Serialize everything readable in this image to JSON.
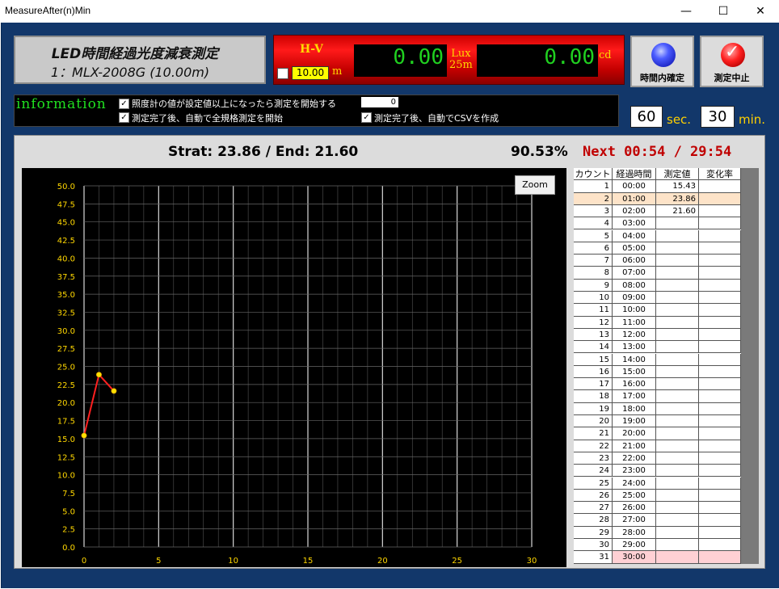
{
  "window": {
    "title": "MeasureAfter(n)Min",
    "minimize": "—",
    "maximize": "☐",
    "close": "✕"
  },
  "header": {
    "title_line1": "LED時間経過光度減衰測定",
    "title_line2": "1：MLX-2008G (10.00m)"
  },
  "meter": {
    "hv_label": "H-V",
    "hv_value": "10.00",
    "hv_unit": "m",
    "lux_value": "0.00",
    "lux_unit_line1": "Lux",
    "lux_unit_line2": "25m",
    "cd_value": "0.00",
    "cd_unit": "cd"
  },
  "buttons": {
    "confirm_label": "時間内確定",
    "stop_label": "測定中止"
  },
  "info": {
    "title": "information",
    "opt1_label": "照度計の値が設定値以上になったら測定を開始する",
    "opt1_value": "0",
    "opt2_label": "測定完了後、自動で全規格測定を開始",
    "opt3_label": "測定完了後、自動でCSVを作成"
  },
  "timing": {
    "sec_value": "60",
    "sec_unit": "sec.",
    "min_value": "30",
    "min_unit": "min."
  },
  "status": {
    "start_end": "Strat: 23.86  / End: 21.60",
    "percent": "90.53%",
    "next": "Next 00:54 / 29:54"
  },
  "zoom_label": "Zoom",
  "table": {
    "headers": [
      "カウント",
      "経過時間",
      "測定値",
      "変化率"
    ],
    "rows": [
      [
        "1",
        "00:00",
        "15.43",
        ""
      ],
      [
        "2",
        "01:00",
        "23.86",
        ""
      ],
      [
        "3",
        "02:00",
        "21.60",
        ""
      ],
      [
        "4",
        "03:00",
        "",
        ""
      ],
      [
        "5",
        "04:00",
        "",
        ""
      ],
      [
        "6",
        "05:00",
        "",
        ""
      ],
      [
        "7",
        "06:00",
        "",
        ""
      ],
      [
        "8",
        "07:00",
        "",
        ""
      ],
      [
        "9",
        "08:00",
        "",
        ""
      ],
      [
        "10",
        "09:00",
        "",
        ""
      ],
      [
        "11",
        "10:00",
        "",
        ""
      ],
      [
        "12",
        "11:00",
        "",
        ""
      ],
      [
        "13",
        "12:00",
        "",
        ""
      ],
      [
        "14",
        "13:00",
        "",
        ""
      ],
      [
        "15",
        "14:00",
        "",
        ""
      ],
      [
        "16",
        "15:00",
        "",
        ""
      ],
      [
        "17",
        "16:00",
        "",
        ""
      ],
      [
        "18",
        "17:00",
        "",
        ""
      ],
      [
        "19",
        "18:00",
        "",
        ""
      ],
      [
        "20",
        "19:00",
        "",
        ""
      ],
      [
        "21",
        "20:00",
        "",
        ""
      ],
      [
        "22",
        "21:00",
        "",
        ""
      ],
      [
        "23",
        "22:00",
        "",
        ""
      ],
      [
        "24",
        "23:00",
        "",
        ""
      ],
      [
        "25",
        "24:00",
        "",
        ""
      ],
      [
        "26",
        "25:00",
        "",
        ""
      ],
      [
        "27",
        "26:00",
        "",
        ""
      ],
      [
        "28",
        "27:00",
        "",
        ""
      ],
      [
        "29",
        "28:00",
        "",
        ""
      ],
      [
        "30",
        "29:00",
        "",
        ""
      ],
      [
        "31",
        "30:00",
        "",
        ""
      ]
    ],
    "highlight_row": 2,
    "highlight_color": "#fde3c8",
    "final_row": 31,
    "final_color": "#ffd0d4"
  },
  "chart_data": {
    "type": "line",
    "x": [
      0,
      1,
      2
    ],
    "y": [
      15.43,
      23.86,
      21.6
    ],
    "xlim": [
      0,
      30
    ],
    "ylim": [
      0,
      50
    ],
    "xticks": [
      0,
      5,
      10,
      15,
      20,
      25,
      30
    ],
    "yticks": [
      "0.0",
      "2.5",
      "5.0",
      "7.5",
      "10.0",
      "12.5",
      "15.0",
      "17.5",
      "20.0",
      "22.5",
      "25.0",
      "27.5",
      "30.0",
      "32.5",
      "35.0",
      "37.5",
      "40.0",
      "42.5",
      "45.0",
      "47.5",
      "50.0"
    ],
    "grid": true,
    "line_color": "#ff2020",
    "marker_color": "#ffe000",
    "tick_color": "#ffd700"
  }
}
